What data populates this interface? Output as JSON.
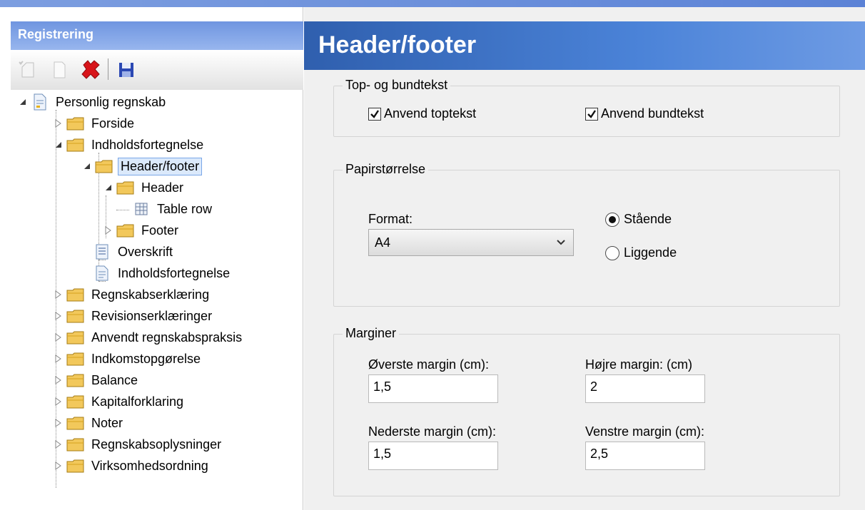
{
  "left_panel": {
    "title": "Registrering",
    "toolbar": [
      "new-item-icon",
      "new-document-icon",
      "delete-icon",
      "save-icon"
    ]
  },
  "tree": {
    "root": "Personlig regnskab",
    "items": [
      {
        "label": "Forside"
      },
      {
        "label": "Indholdsfortegnelse"
      },
      {
        "label": "Header/footer",
        "selected": true
      },
      {
        "label": "Header"
      },
      {
        "label": "Table row"
      },
      {
        "label": "Footer"
      },
      {
        "label": "Overskrift"
      },
      {
        "label": "Indholdsfortegnelse"
      },
      {
        "label": "Regnskabserklæring"
      },
      {
        "label": "Revisionserklæringer"
      },
      {
        "label": "Anvendt regnskabspraksis"
      },
      {
        "label": "Indkomstopgørelse"
      },
      {
        "label": "Balance"
      },
      {
        "label": "Kapitalforklaring"
      },
      {
        "label": "Noter"
      },
      {
        "label": "Regnskabsoplysninger"
      },
      {
        "label": "Virksomhedsordning"
      }
    ]
  },
  "main": {
    "title": "Header/footer",
    "top_bottom": {
      "legend": "Top- og bundtekst",
      "use_header_label": "Anvend toptekst",
      "use_header_checked": true,
      "use_footer_label": "Anvend bundtekst",
      "use_footer_checked": true
    },
    "paper": {
      "legend": "Papirstørrelse",
      "format_label": "Format:",
      "format_value": "A4",
      "portrait_label": "Stående",
      "landscape_label": "Liggende",
      "orientation": "portrait"
    },
    "margins": {
      "legend": "Marginer",
      "top_label": "Øverste margin (cm):",
      "top_value": "1,5",
      "right_label": "Højre margin: (cm)",
      "right_value": "2",
      "bottom_label": "Nederste margin (cm):",
      "bottom_value": "1,5",
      "left_label": "Venstre margin (cm):",
      "left_value": "2,5"
    }
  },
  "colors": {
    "header_band": "#2f5fae",
    "panel_title": "#6f95e0",
    "selection_border": "#7aa7e8",
    "folder": "#f2c85b"
  }
}
